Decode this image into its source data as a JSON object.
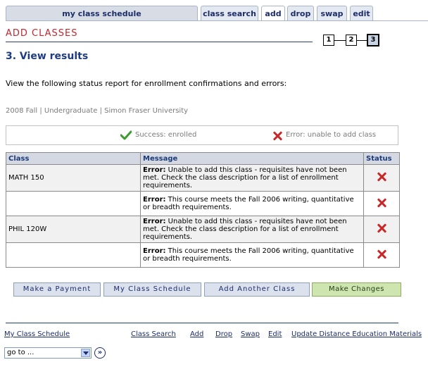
{
  "tabs": [
    {
      "label": "my class schedule"
    },
    {
      "label": "class search"
    },
    {
      "label": "add"
    },
    {
      "label": "drop"
    },
    {
      "label": "swap"
    },
    {
      "label": "edit"
    }
  ],
  "page_title": "ADD CLASSES",
  "steps": [
    "1",
    "2",
    "3"
  ],
  "subheading": "3. View results",
  "instructions": "View the following status report for enrollment confirmations and errors:",
  "term": "2008 Fall | Undergraduate | Simon Fraser University",
  "legend": {
    "success": "Success: enrolled",
    "error": "Error: unable to add class"
  },
  "table": {
    "headers": [
      "Class",
      "Message",
      "Status"
    ],
    "rows": [
      {
        "class": "MATH  150",
        "msg_label": "Error:",
        "msg_text": " Unable to add this class - requisites have not been met. Check the class description for a list of enrollment requirements.",
        "status": "error"
      },
      {
        "class": "",
        "msg_label": "Error:",
        "msg_text": " This course meets the Fall 2006 writing, quantitative or breadth requirements.",
        "status": "error"
      },
      {
        "class": "PHIL  120W",
        "msg_label": "Error:",
        "msg_text": " Unable to add this class - requisites have not been met. Check the class description for a list of enrollment requirements.",
        "status": "error"
      },
      {
        "class": "",
        "msg_label": "Error:",
        "msg_text": " This course meets the Fall 2006 writing, quantitative or breadth requirements.",
        "status": "error"
      }
    ]
  },
  "buttons": {
    "make_payment": "Make a Payment",
    "my_class_schedule": "My Class Schedule",
    "add_another_class": "Add Another Class",
    "make_changes": "Make Changes"
  },
  "footer_links": {
    "my_class_schedule": "My Class Schedule",
    "class_search": "Class Search",
    "add": "Add",
    "drop": "Drop",
    "swap": "Swap",
    "edit": "Edit",
    "distance": "Update Distance Education Materials"
  },
  "goto": {
    "value": "go to ..."
  },
  "colors": {
    "title_red": "#c4262e",
    "heading_blue": "#1e3c82",
    "error_red": "#c8282a",
    "success_green": "#3c9a2f"
  }
}
